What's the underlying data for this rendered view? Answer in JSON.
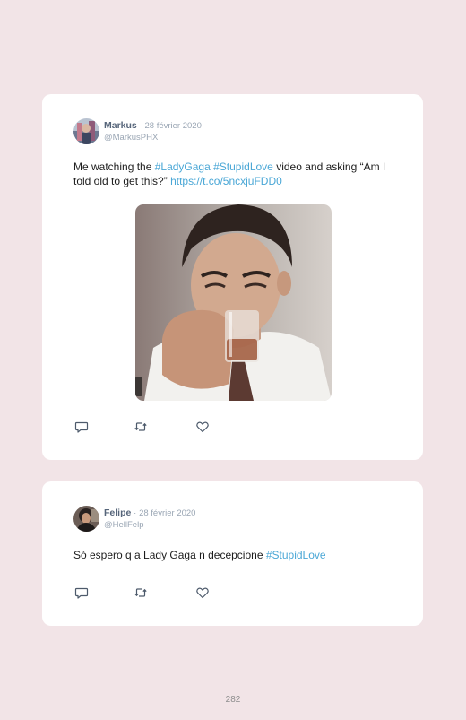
{
  "tweets": [
    {
      "name": "Markus",
      "separator": "·",
      "date": "28 février 2020",
      "handle": "@MarkusPHX",
      "text": {
        "part1": "Me watching the ",
        "tag1": "#LadyGaga",
        "space": " ",
        "tag2": "#StupidLove",
        "part2": " video and asking “Am I told old to get this?” ",
        "link": "https://t.co/5ncxjuFDD0"
      },
      "has_media": true,
      "media_description": "man drinking from a glass"
    },
    {
      "name": "Felipe",
      "separator": "·",
      "date": "28 février 2020",
      "handle": "@HellFelp",
      "text": {
        "part1": "Só espero q a Lady Gaga n decepcione ",
        "tag1": "#StupidLove"
      },
      "has_media": false
    }
  ],
  "actions": {
    "reply_icon": "reply-icon",
    "retweet_icon": "retweet-icon",
    "like_icon": "heart-icon"
  },
  "colors": {
    "background": "#f2e4e7",
    "card": "#ffffff",
    "name": "#56657a",
    "muted": "#9aa6b4",
    "hashtag": "#4aa7d6",
    "icon": "#4d5a6b"
  },
  "page_number": "282"
}
